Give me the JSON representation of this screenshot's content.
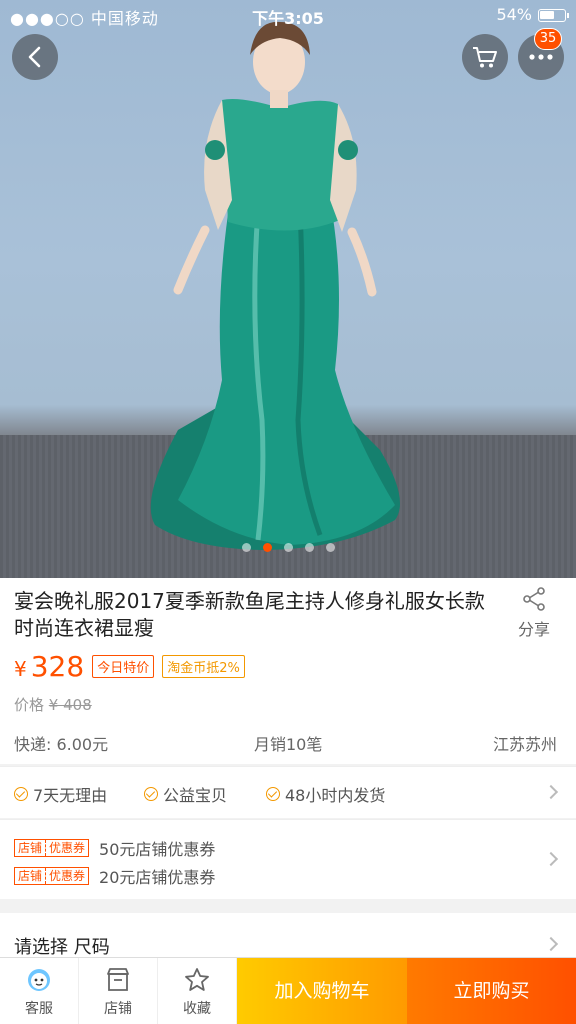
{
  "status_bar": {
    "carrier": "●●●○○ 中国移动",
    "time": "下午3:05",
    "battery": "54%"
  },
  "header": {
    "back_icon": "chevron-left-icon",
    "cart_icon": "cart-icon",
    "more_icon": "more-dots-icon",
    "notification_count": "35"
  },
  "gallery": {
    "image_count": 5,
    "active_index": 1
  },
  "product": {
    "title": "宴会晚礼服2017夏季新款鱼尾主持人修身礼服女长款时尚连衣裙显瘦",
    "share_label": "分享",
    "currency": "¥",
    "price": "328",
    "tag_today": "今日特价",
    "tag_coin": "淘金币抵2%",
    "original_label": "价格",
    "original_price": "¥ 408",
    "shipping": "快递: 6.00元",
    "monthly_sales": "月销10笔",
    "location": "江苏苏州"
  },
  "guarantees": [
    "7天无理由",
    "公益宝贝",
    "48小时内发货"
  ],
  "coupons": {
    "tag_store": "店铺",
    "tag_coupon": "优惠券",
    "items": [
      "50元店铺优惠券",
      "20元店铺优惠券"
    ]
  },
  "select": {
    "label": "请选择 尺码"
  },
  "bottom_bar": {
    "service": "客服",
    "store": "店铺",
    "favorite": "收藏",
    "add_to_cart": "加入购物车",
    "buy_now": "立即购买"
  },
  "colors": {
    "accent": "#ff5000",
    "cart_button": "#ff9a00",
    "dress": "#1a9a84"
  }
}
